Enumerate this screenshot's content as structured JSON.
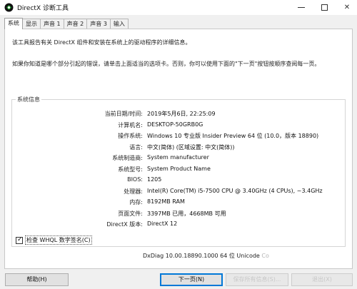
{
  "window": {
    "title": "DirectX 诊断工具",
    "close_glyph": "✕"
  },
  "tabs": [
    {
      "label": "系统",
      "active": true
    },
    {
      "label": "显示",
      "active": false
    },
    {
      "label": "声音 1",
      "active": false
    },
    {
      "label": "声音 2",
      "active": false
    },
    {
      "label": "声音 3",
      "active": false
    },
    {
      "label": "输入",
      "active": false
    }
  ],
  "intro": {
    "line1": "该工具报告有关 DirectX 组件和安装在系统上的驱动程序的详细信息。",
    "line2": "如果你知道是哪个部分引起的错误，请单击上面适当的选项卡。否则，你可以使用下面的\"下一页\"按钮按顺序查阅每一页。"
  },
  "system_info": {
    "group_title": "系统信息",
    "rows": [
      {
        "label": "当前日期/时间:",
        "value": "2019年5月6日, 22:25:09"
      },
      {
        "label": "计算机名:",
        "value": "DESKTOP-50GRB0G"
      },
      {
        "label": "操作系统:",
        "value": "Windows 10 专业版 Insider Preview 64 位 (10.0，版本 18890)"
      },
      {
        "label": "语言:",
        "value": "中文(简体) (区域设置: 中文(简体))"
      },
      {
        "label": "系统制造商:",
        "value": "System manufacturer"
      },
      {
        "label": "系统型号:",
        "value": "System Product Name"
      },
      {
        "label": "BIOS:",
        "value": "1205"
      },
      {
        "label": "处理器:",
        "value": "Intel(R) Core(TM) i5-7500 CPU @ 3.40GHz (4 CPUs), ~3.4GHz"
      },
      {
        "label": "内存:",
        "value": "8192MB RAM"
      },
      {
        "label": "页面文件:",
        "value": "3397MB 已用，4668MB 可用"
      },
      {
        "label": "DirectX 版本:",
        "value": "DirectX 12"
      }
    ]
  },
  "whql_checkbox": {
    "label": "检查 WHQL 数字签名(C)",
    "checked": true,
    "check_glyph": "✓"
  },
  "footer": {
    "version_text": "DxDiag 10.00.18890.1000 64 位 Unicode",
    "version_faded": " Co"
  },
  "buttons": {
    "help": "帮助(H)",
    "next": "下一页(N)",
    "save": "保存所有信息(S)...",
    "exit": "退出(X)"
  },
  "colors": {
    "accent": "#0078d7",
    "icon_green": "#1a9a2a",
    "icon_black": "#111111"
  }
}
